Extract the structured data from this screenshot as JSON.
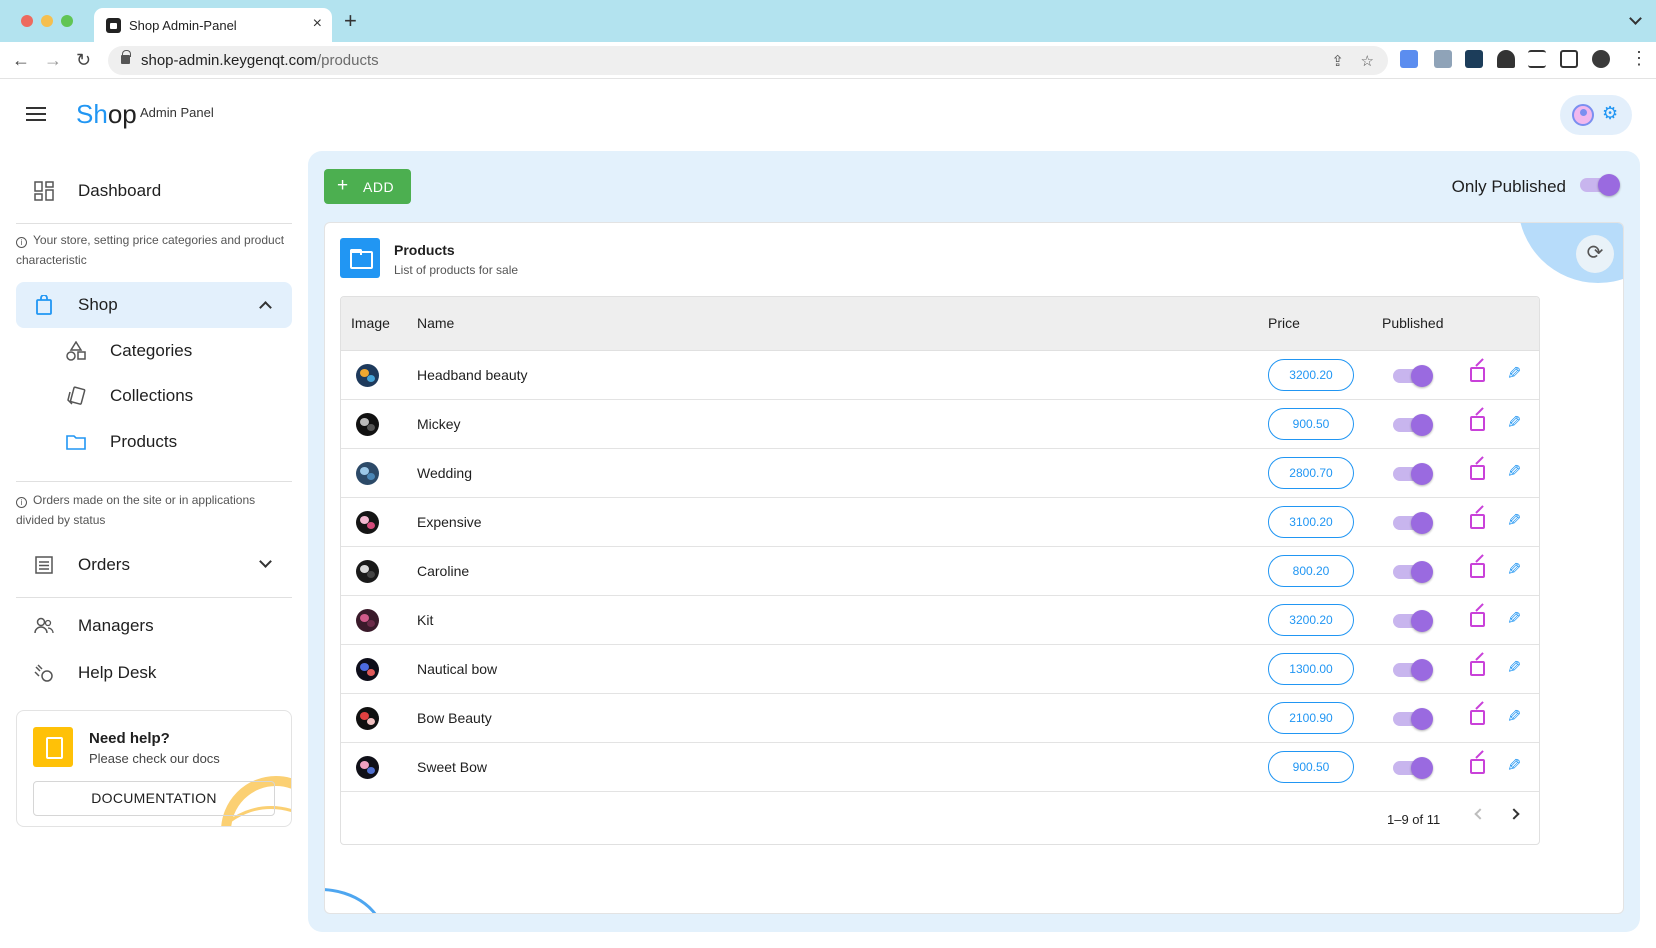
{
  "browser": {
    "tab_title": "Shop Admin-Panel",
    "tab_close": "×",
    "new_tab": "+",
    "back": "←",
    "forward": "→",
    "reload": "↻",
    "url_host": "shop-admin.keygenqt.com",
    "url_path": "/products",
    "share_icon": "⇪",
    "star_icon": "☆",
    "menu_icon": "⋮"
  },
  "app": {
    "brand_part1": "Sh",
    "brand_part2": "op",
    "brand_sub": "Admin Panel"
  },
  "sidebar": {
    "dashboard": "Dashboard",
    "shop_hint": "Your store, setting price categories and product characteristic",
    "shop": "Shop",
    "categories": "Categories",
    "collections": "Collections",
    "products": "Products",
    "orders_hint": "Orders made on the site or in applications divided by status",
    "orders": "Orders",
    "managers": "Managers",
    "help_desk": "Help Desk",
    "help_title": "Need help?",
    "help_sub": "Please check our docs",
    "help_button": "DOCUMENTATION"
  },
  "toolbar": {
    "add_plus": "+",
    "add_label": "ADD",
    "only_published_label": "Only Published",
    "only_published": true
  },
  "card": {
    "title": "Products",
    "subtitle": "List of products for sale",
    "refresh_icon": "⟳"
  },
  "table": {
    "headers": {
      "image": "Image",
      "name": "Name",
      "price": "Price",
      "published": "Published"
    },
    "rows": [
      {
        "name": "Headband beauty",
        "price": "3200.20",
        "published": true
      },
      {
        "name": "Mickey",
        "price": "900.50",
        "published": true
      },
      {
        "name": "Wedding",
        "price": "2800.70",
        "published": true
      },
      {
        "name": "Expensive",
        "price": "3100.20",
        "published": true
      },
      {
        "name": "Caroline",
        "price": "800.20",
        "published": true
      },
      {
        "name": "Kit",
        "price": "3200.20",
        "published": true
      },
      {
        "name": "Nautical bow",
        "price": "1300.00",
        "published": true
      },
      {
        "name": "Bow Beauty",
        "price": "2100.90",
        "published": true
      },
      {
        "name": "Sweet Bow",
        "price": "900.50",
        "published": true
      }
    ],
    "edit_icon": "✎",
    "pagination": "1–9 of 11"
  },
  "colors": {
    "accent": "#2196f3",
    "add_button": "#4caf50",
    "toggle_on": "#9a6ae0",
    "open_icon": "#c941d9",
    "help_icon": "#ffc107"
  }
}
